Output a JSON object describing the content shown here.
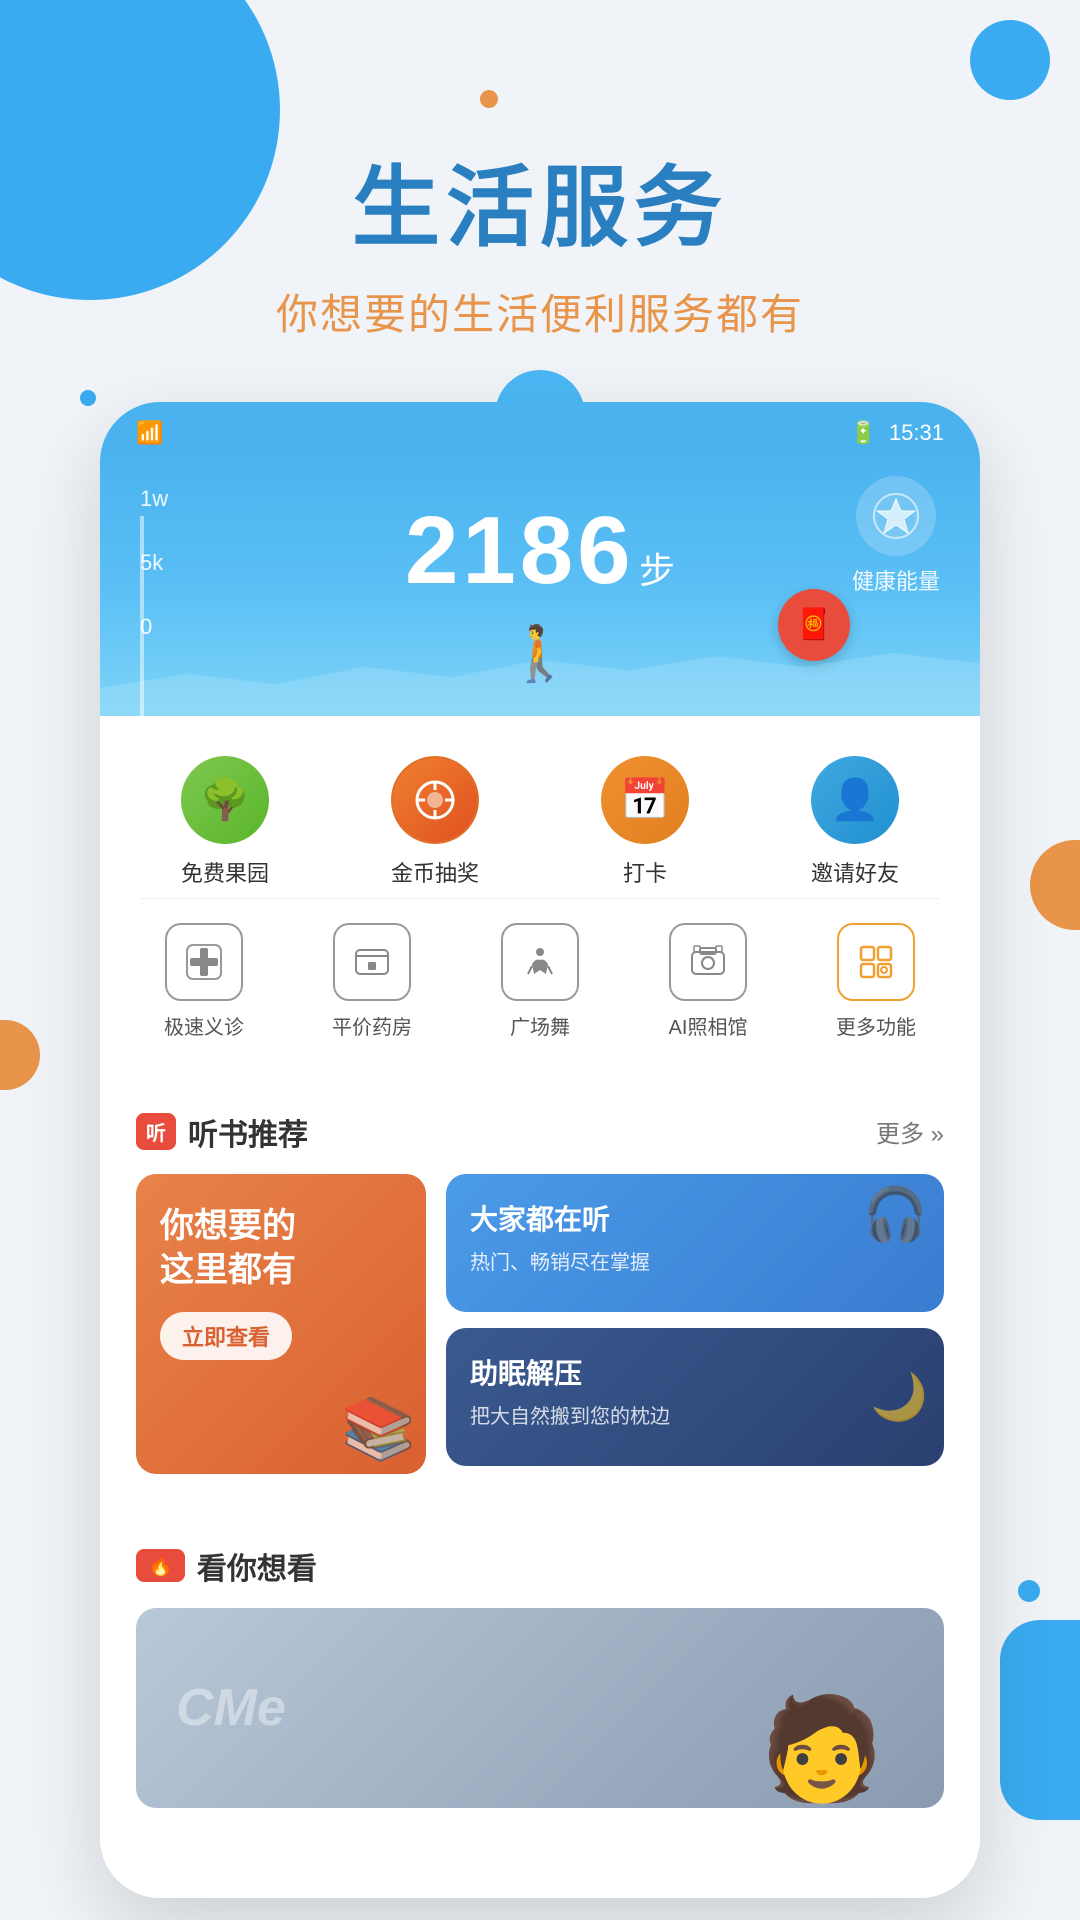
{
  "hero": {
    "title": "生活服务",
    "subtitle": "你想要的生活便利服务都有"
  },
  "status_bar": {
    "time": "15:31",
    "wifi_icon": "📶",
    "battery_icon": "🔋"
  },
  "step_counter": {
    "steps": "2186",
    "unit": "步",
    "chart_labels": [
      "1w",
      "5k",
      "0"
    ],
    "health_energy": "健康能量"
  },
  "icon_row1": [
    {
      "label": "免费果园",
      "emoji": "🌳",
      "color": "green"
    },
    {
      "label": "金币抽奖",
      "emoji": "🎯",
      "color": "orange-red"
    },
    {
      "label": "打卡",
      "emoji": "📅",
      "color": "orange"
    },
    {
      "label": "邀请好友",
      "emoji": "👤",
      "color": "blue"
    }
  ],
  "icon_row2": [
    {
      "label": "极速义诊",
      "emoji": "➕",
      "special": false
    },
    {
      "label": "平价药房",
      "emoji": "🖼",
      "special": false
    },
    {
      "label": "广场舞",
      "emoji": "💃",
      "special": false
    },
    {
      "label": "AI照相馆",
      "emoji": "📷",
      "special": false
    },
    {
      "label": "更多功能",
      "emoji": "⊞",
      "special": true
    }
  ],
  "book_section": {
    "badge": "听",
    "title": "听书推荐",
    "more": "更多 »",
    "card_left": {
      "title": "你想要的\n这里都有",
      "button": "立即查看"
    },
    "card_top": {
      "title": "大家都在听",
      "subtitle": "热门、畅销尽在掌握"
    },
    "card_bottom": {
      "title": "助眠解压",
      "subtitle": "把大自然搬到您的枕边"
    }
  },
  "watch_section": {
    "badge": "🔥",
    "title": "看你想看",
    "cme_label": "CMe"
  }
}
